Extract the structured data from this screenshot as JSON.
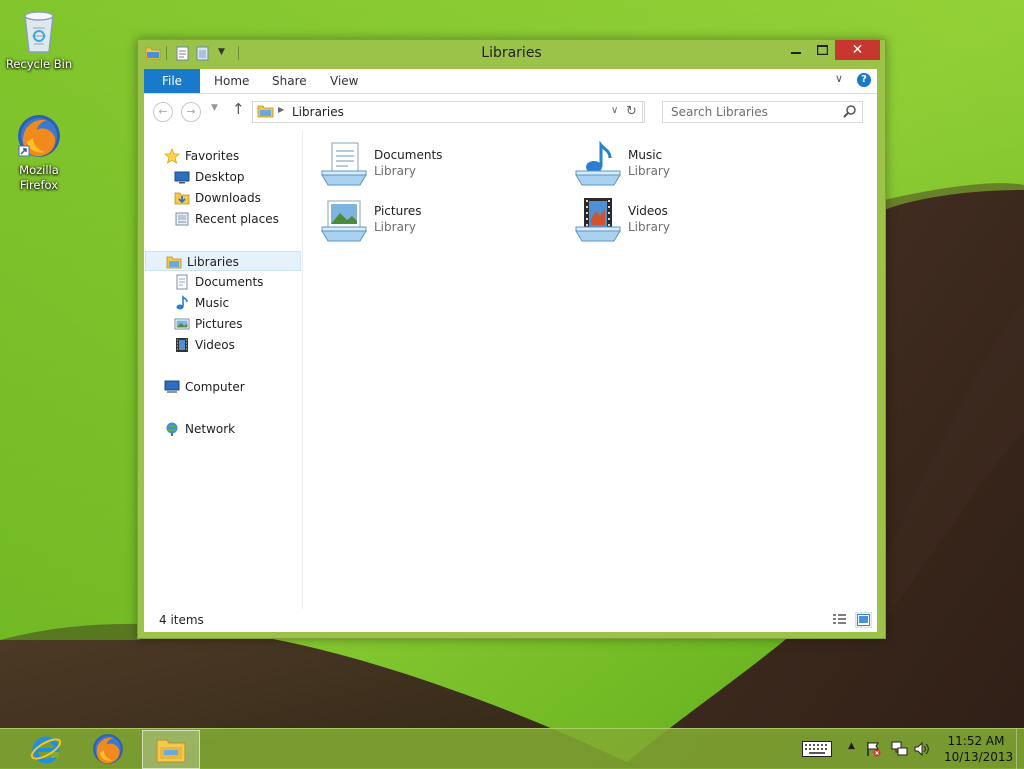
{
  "desktop": {
    "icons": [
      {
        "label": "Recycle Bin",
        "icon": "recycle-bin-icon"
      },
      {
        "label": "Mozilla Firefox",
        "icon": "firefox-icon"
      }
    ]
  },
  "window": {
    "title": "Libraries",
    "accent_color": "#9bc34a",
    "close_color": "#c7372f",
    "ribbon": {
      "tabs": [
        {
          "label": "File",
          "active_color": "#1979ca"
        },
        {
          "label": "Home"
        },
        {
          "label": "Share"
        },
        {
          "label": "View"
        }
      ],
      "help_label": "?"
    },
    "address": {
      "path": "Libraries",
      "search_placeholder": "Search Libraries"
    },
    "nav_pane": {
      "favorites": {
        "label": "Favorites",
        "items": [
          {
            "label": "Desktop",
            "icon": "desktop-icon"
          },
          {
            "label": "Downloads",
            "icon": "downloads-icon"
          },
          {
            "label": "Recent places",
            "icon": "recent-places-icon"
          }
        ]
      },
      "libraries": {
        "label": "Libraries",
        "items": [
          {
            "label": "Documents",
            "icon": "documents-icon"
          },
          {
            "label": "Music",
            "icon": "music-icon"
          },
          {
            "label": "Pictures",
            "icon": "pictures-icon"
          },
          {
            "label": "Videos",
            "icon": "videos-icon"
          }
        ]
      },
      "computer": {
        "label": "Computer"
      },
      "network": {
        "label": "Network"
      }
    },
    "content": {
      "libraries": [
        {
          "name": "Documents",
          "type": "Library",
          "icon": "documents-library-icon"
        },
        {
          "name": "Music",
          "type": "Library",
          "icon": "music-library-icon"
        },
        {
          "name": "Pictures",
          "type": "Library",
          "icon": "pictures-library-icon"
        },
        {
          "name": "Videos",
          "type": "Library",
          "icon": "videos-library-icon"
        }
      ]
    },
    "status": {
      "item_count": "4 items"
    }
  },
  "taskbar": {
    "pinned": [
      {
        "name": "Internet Explorer",
        "icon": "internet-explorer-icon"
      },
      {
        "name": "Firefox",
        "icon": "firefox-icon"
      },
      {
        "name": "File Explorer",
        "icon": "file-explorer-icon"
      }
    ],
    "clock": {
      "time": "11:52 AM",
      "date": "10/13/2013"
    }
  }
}
